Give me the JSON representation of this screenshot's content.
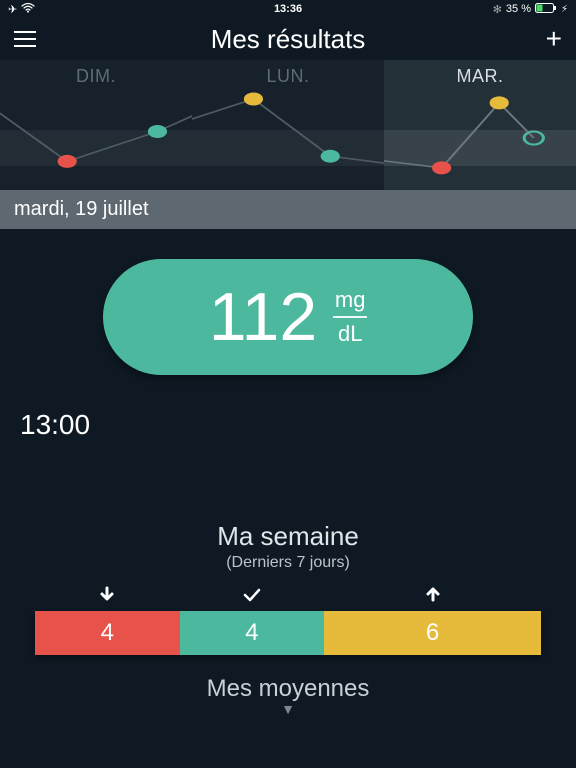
{
  "status": {
    "time": "13:36",
    "battery": "35 %",
    "bluetooth": true,
    "airplane": true
  },
  "header": {
    "title": "Mes résultats"
  },
  "days": [
    {
      "label": "DIM.",
      "active": false
    },
    {
      "label": "LUN.",
      "active": false
    },
    {
      "label": "MAR.",
      "active": true
    }
  ],
  "chart_data": {
    "type": "line",
    "note": "Three day mini-trend panels; y is approximate glucose position (higher = higher reading). Colors indicate range status.",
    "series": [
      {
        "name": "DIM.",
        "points": [
          {
            "x": 0.35,
            "y": 0.78,
            "color": "#e7524a"
          },
          {
            "x": 0.82,
            "y": 0.55,
            "color": "#4cb89e"
          }
        ]
      },
      {
        "name": "LUN.",
        "points": [
          {
            "x": 0.32,
            "y": 0.3,
            "color": "#e6bb3c"
          },
          {
            "x": 0.72,
            "y": 0.74,
            "color": "#4cb89e"
          }
        ]
      },
      {
        "name": "MAR.",
        "points": [
          {
            "x": 0.3,
            "y": 0.83,
            "color": "#e7524a"
          },
          {
            "x": 0.6,
            "y": 0.33,
            "color": "#e6bb3c"
          },
          {
            "x": 0.78,
            "y": 0.6,
            "color": "none",
            "stroke": "#4cb89e"
          }
        ]
      }
    ]
  },
  "date_bar": "mardi, 19 juillet",
  "reading": {
    "value": "112",
    "unit_top": "mg",
    "unit_bottom": "dL"
  },
  "time": "13:00",
  "week": {
    "title": "Ma semaine",
    "subtitle": "(Derniers 7 jours)",
    "segments": {
      "low": "4",
      "ok": "4",
      "high": "6"
    }
  },
  "averages_label": "Mes moyennes"
}
